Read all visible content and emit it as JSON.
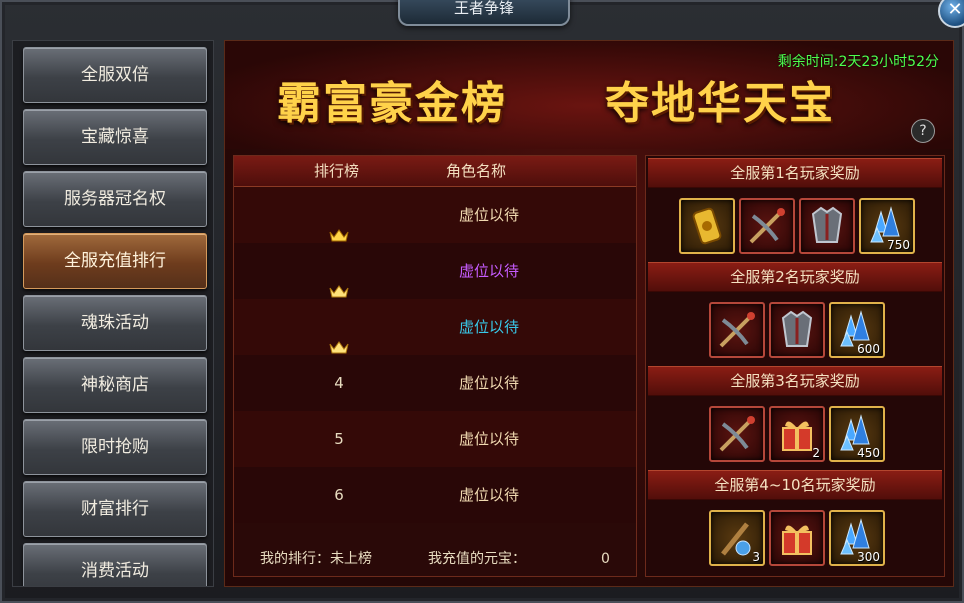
{
  "window": {
    "title": "王者争锋",
    "close": "✕"
  },
  "sidebar": {
    "items": [
      {
        "label": "全服双倍",
        "active": false
      },
      {
        "label": "宝藏惊喜",
        "active": false
      },
      {
        "label": "服务器冠名权",
        "active": false
      },
      {
        "label": "全服充值排行",
        "active": true
      },
      {
        "label": "魂珠活动",
        "active": false
      },
      {
        "label": "神秘商店",
        "active": false
      },
      {
        "label": "限时抢购",
        "active": false
      },
      {
        "label": "财富排行",
        "active": false
      },
      {
        "label": "消费活动",
        "active": false
      }
    ]
  },
  "banner": {
    "title_left": "霸富豪金榜",
    "title_right": "夺地华天宝",
    "timer": "剩余时间:2天23小时52分",
    "help": "?"
  },
  "ranking": {
    "headers": [
      "排行榜",
      "角色名称"
    ],
    "rows": [
      {
        "rank": "",
        "icon": "gold-crown-icon",
        "name": "虚位以待",
        "color": "#f0d9b0"
      },
      {
        "rank": "",
        "icon": "silver-crown-icon",
        "name": "虚位以待",
        "color": "#c65cff"
      },
      {
        "rank": "",
        "icon": "bronze-crown-icon",
        "name": "虚位以待",
        "color": "#38c8e8"
      },
      {
        "rank": "4",
        "icon": "",
        "name": "虚位以待",
        "color": "#f0d9b0"
      },
      {
        "rank": "5",
        "icon": "",
        "name": "虚位以待",
        "color": "#f0d9b0"
      },
      {
        "rank": "6",
        "icon": "",
        "name": "虚位以待",
        "color": "#f0d9b0"
      }
    ],
    "my_rank_label": "我的排行：未上榜",
    "my_recharge_label": "我充值的元宝：",
    "my_recharge_value": "0"
  },
  "rewards": {
    "tiers": [
      {
        "label": "全服第1名玩家奖励",
        "items": [
          {
            "icon": "gold-badge-icon",
            "count": "",
            "style": "gold"
          },
          {
            "icon": "crossbow-icon",
            "count": "",
            "style": "red"
          },
          {
            "icon": "armor-icon",
            "count": "",
            "style": "red"
          },
          {
            "icon": "blue-crystal-icon",
            "count": "750",
            "style": "gold"
          }
        ]
      },
      {
        "label": "全服第2名玩家奖励",
        "items": [
          {
            "icon": "crossbow-icon",
            "count": "",
            "style": "red"
          },
          {
            "icon": "armor-icon",
            "count": "",
            "style": "red"
          },
          {
            "icon": "blue-crystal-icon",
            "count": "600",
            "style": "gold"
          }
        ]
      },
      {
        "label": "全服第3名玩家奖励",
        "items": [
          {
            "icon": "crossbow-icon",
            "count": "",
            "style": "red"
          },
          {
            "icon": "gift-box-icon",
            "count": "2",
            "style": "red"
          },
          {
            "icon": "blue-crystal-icon",
            "count": "450",
            "style": "gold"
          }
        ]
      },
      {
        "label": "全服第4~10名玩家奖励",
        "items": [
          {
            "icon": "staff-orb-icon",
            "count": "3",
            "style": "gold"
          },
          {
            "icon": "gift-box-icon",
            "count": "",
            "style": "red"
          },
          {
            "icon": "blue-crystal-icon",
            "count": "300",
            "style": "gold"
          }
        ]
      }
    ]
  }
}
